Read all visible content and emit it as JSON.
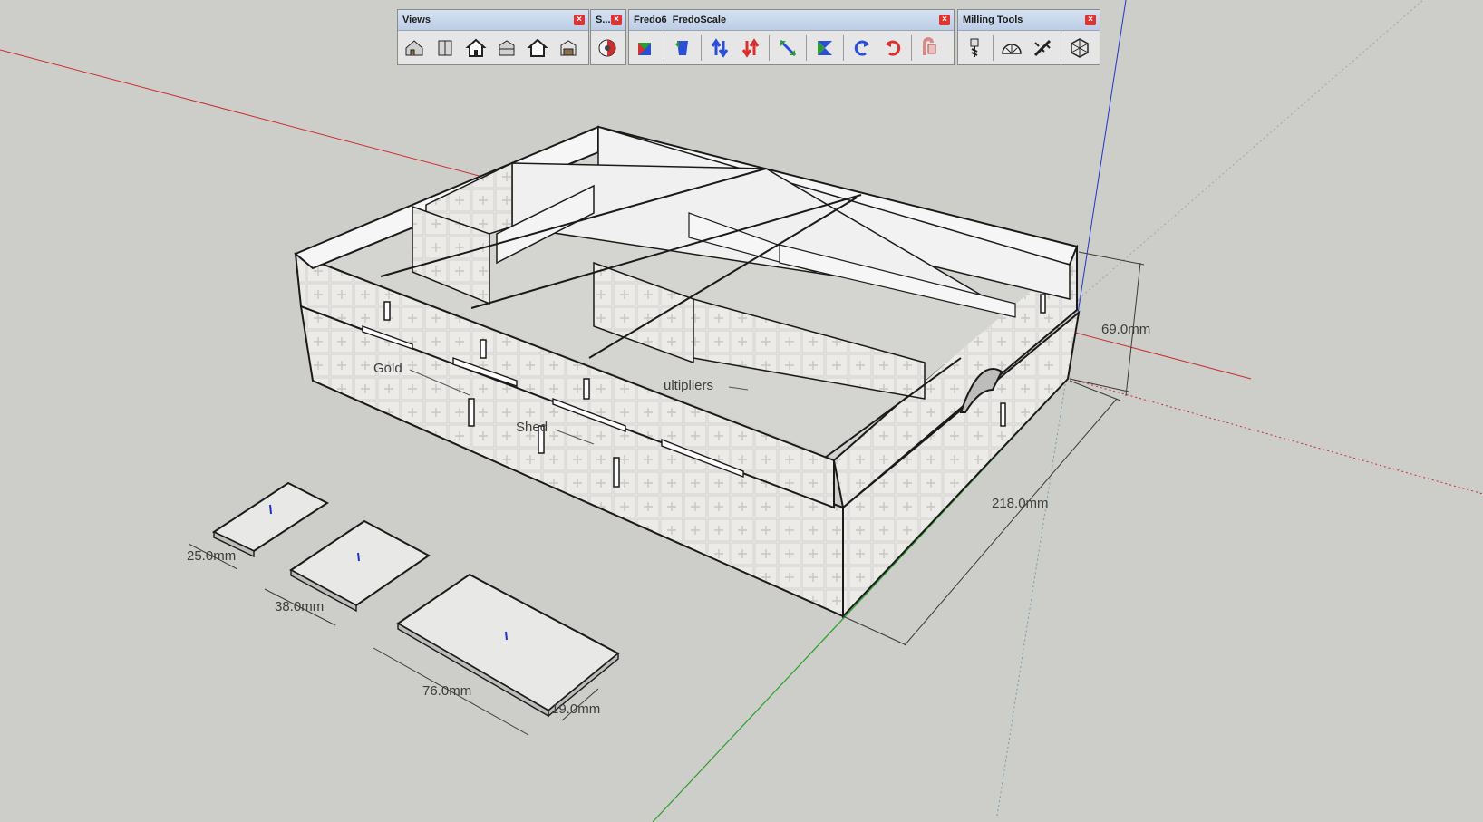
{
  "toolbars": {
    "views": {
      "title": "Views",
      "buttons": [
        "iso-view-icon",
        "top-view-icon",
        "front-view-icon",
        "right-view-icon",
        "back-view-icon",
        "left-view-icon"
      ]
    },
    "styles": {
      "title": "S...",
      "buttons": [
        "styles-icon"
      ]
    },
    "fredoscale": {
      "title": "Fredo6_FredoScale",
      "buttons": [
        "box-scale-icon",
        "tapering-icon",
        "stretch-up-icon",
        "stretch-down-icon",
        "radial-bend-icon",
        "twist-icon",
        "rotate-ccw-icon",
        "rotate-cw-icon",
        "unbend-icon"
      ]
    },
    "milling": {
      "title": "Milling Tools",
      "buttons": [
        "mill-bit-icon",
        "protractor-icon",
        "caliper-icon",
        "cube-network-icon"
      ]
    },
    "close_glyph": "×"
  },
  "model": {
    "labels": {
      "gold": "Gold",
      "shed": "Shed",
      "multipliers": "ultipliers"
    },
    "dimensions": {
      "height": "69.0mm",
      "length": "218.0mm",
      "tile_small": "25.0mm",
      "tile_medium": "38.0mm",
      "tile_large": "76.0mm",
      "tile_thickness": "19.0mm"
    }
  },
  "colors": {
    "background": "#cdcdc9",
    "red_axis": "#c83030",
    "green_axis": "#2aa02a",
    "blue_axis": "#2233cc"
  }
}
